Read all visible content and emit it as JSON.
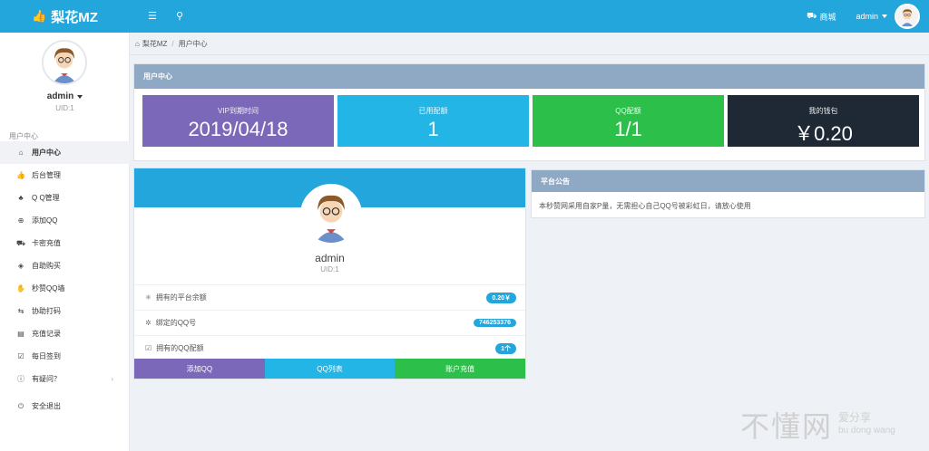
{
  "topbar": {
    "brand": "梨花MZ",
    "shop_label": "商城",
    "user_label": "admin"
  },
  "sidebar": {
    "username": "admin",
    "uid": "UID:1",
    "section_label": "用户中心",
    "items": [
      {
        "label": "用户中心",
        "icon": "home-icon",
        "glyph": "⌂"
      },
      {
        "label": "后台管理",
        "icon": "thumbs-up-icon",
        "glyph": "👍"
      },
      {
        "label": "Q Q管理",
        "icon": "qq-icon",
        "glyph": "♣"
      },
      {
        "label": "添加QQ",
        "icon": "plus-circle-icon",
        "glyph": "⊕"
      },
      {
        "label": "卡密充值",
        "icon": "cart-icon",
        "glyph": "⛟"
      },
      {
        "label": "自助购买",
        "icon": "tags-icon",
        "glyph": "◈"
      },
      {
        "label": "秒赞QQ墙",
        "icon": "thumbs-up-icon",
        "glyph": "✋"
      },
      {
        "label": "协助打码",
        "icon": "exchange-icon",
        "glyph": "⇆"
      },
      {
        "label": "充值记录",
        "icon": "list-icon",
        "glyph": "▤"
      },
      {
        "label": "每日签到",
        "icon": "check-square-icon",
        "glyph": "☑"
      },
      {
        "label": "有疑问？",
        "icon": "info-icon",
        "glyph": "ⓘ",
        "arrow": "›"
      }
    ],
    "logout_label": "安全退出"
  },
  "breadcrumb": {
    "home": "梨花MZ",
    "current": "用户中心"
  },
  "user_panel": {
    "title": "用户中心",
    "stats": [
      {
        "label": "VIP到期时间",
        "value": "2019/04/18",
        "color": "#7b68b9"
      },
      {
        "label": "已用配额",
        "value": "1",
        "color": "#23b5e6"
      },
      {
        "label": "QQ配额",
        "value": "1/1",
        "color": "#2cc04a"
      },
      {
        "label": "我的钱包",
        "value": "￥0.20",
        "color": "#1f2936"
      }
    ]
  },
  "profile": {
    "name": "admin",
    "uid": "UID:1",
    "rows": [
      {
        "label": "拥有的平台余额",
        "badge": "0.20￥",
        "icon": "asterisk-icon",
        "glyph": "✳"
      },
      {
        "label": "绑定的QQ号",
        "badge": "746253376",
        "icon": "gear-icon",
        "glyph": "✲"
      },
      {
        "label": "拥有的QQ配额",
        "badge": "1个",
        "icon": "check-square-icon",
        "glyph": "☑"
      }
    ],
    "buttons": [
      {
        "label": "添加QQ",
        "color": "#7b68b9"
      },
      {
        "label": "QQ列表",
        "color": "#23b5e6"
      },
      {
        "label": "账户充值",
        "color": "#2cc04a"
      }
    ]
  },
  "notice": {
    "title": "平台公告",
    "text": "本秒赞网采用自家P量，无需担心自己QQ号被彩虹日，请放心使用"
  },
  "watermark": {
    "big": "不懂网",
    "small": "爱分享",
    "pinyin": "bu dong wang"
  }
}
